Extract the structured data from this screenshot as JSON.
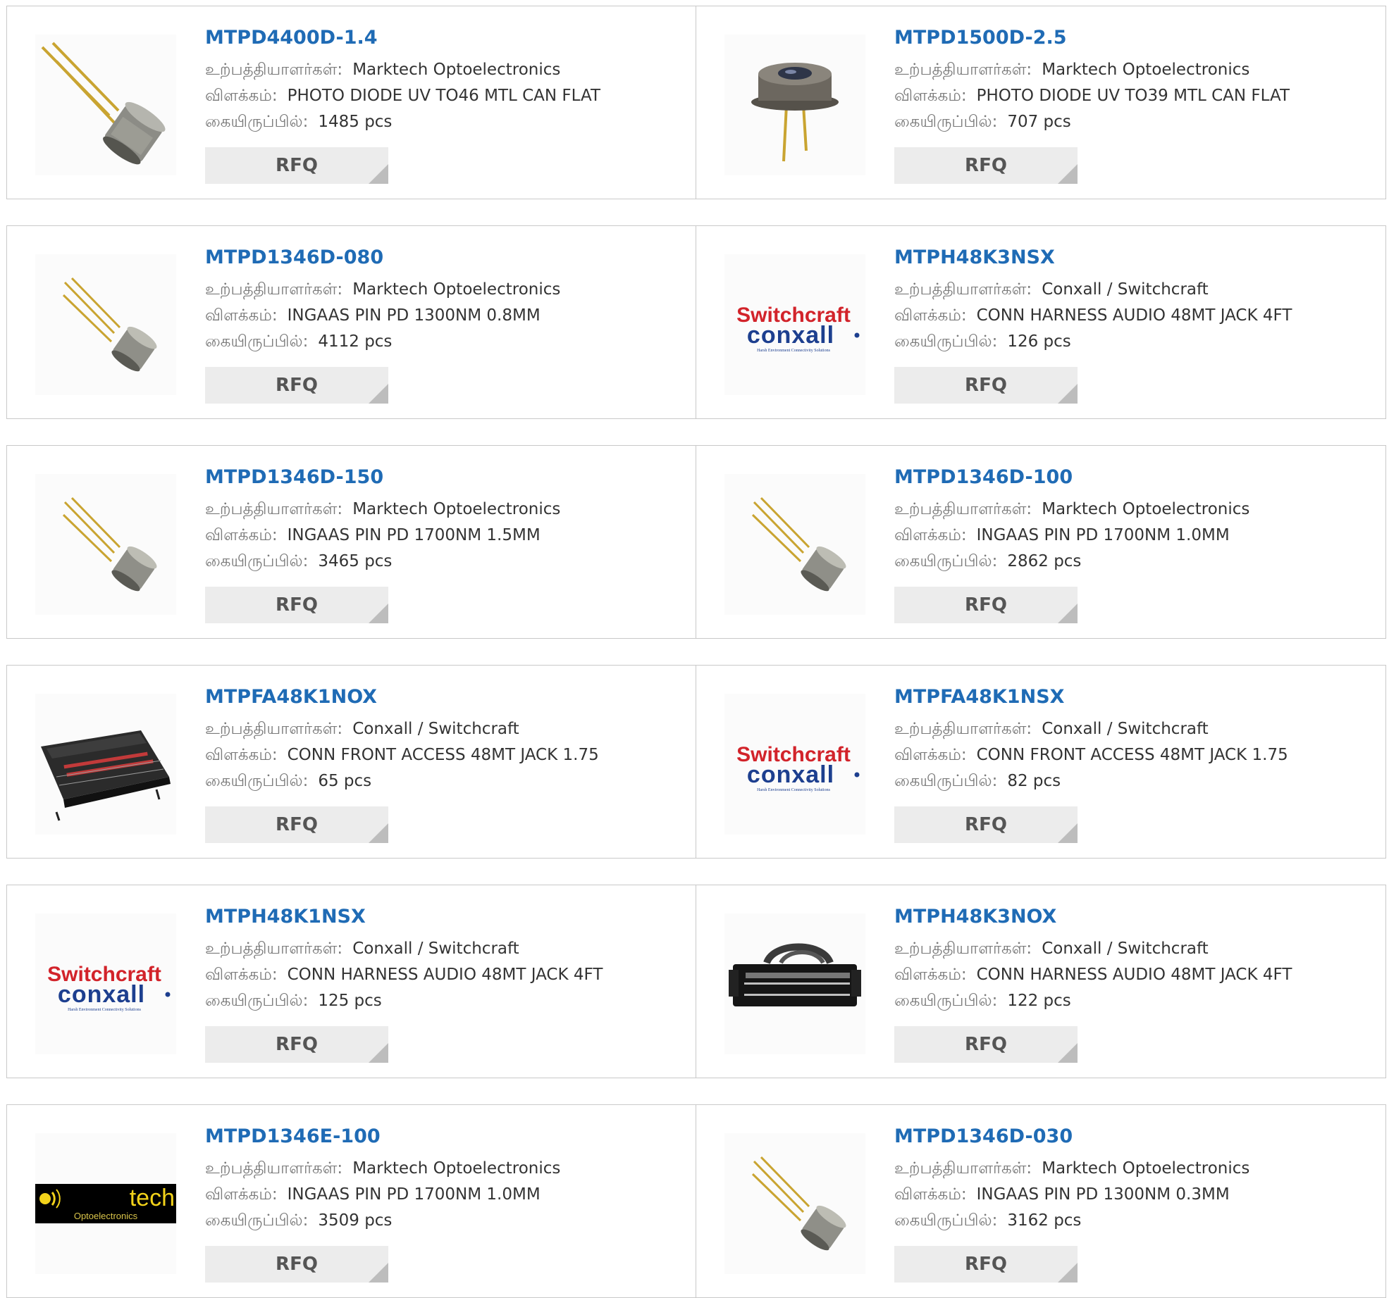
{
  "labels": {
    "manufacturer": "உற்பத்தியாளர்கள்:",
    "description": "விளக்கம்:",
    "stock": "கையிருப்பில்:",
    "rfq": "RFQ"
  },
  "products": [
    {
      "part": "MTPD4400D-1.4",
      "manufacturer": "Marktech Optoelectronics",
      "description": "PHOTO DIODE UV TO46 MTL CAN FLAT",
      "stock": "1485 pcs",
      "image": "photodiode-can-long-leads"
    },
    {
      "part": "MTPD1500D-2.5",
      "manufacturer": "Marktech Optoelectronics",
      "description": "PHOTO DIODE UV TO39 MTL CAN FLAT",
      "stock": "707 pcs",
      "image": "photodiode-to39-window"
    },
    {
      "part": "MTPD1346D-080",
      "manufacturer": "Marktech Optoelectronics",
      "description": "INGAAS PIN PD 1300NM 0.8MM",
      "stock": "4112 pcs",
      "image": "photodiode-can-small"
    },
    {
      "part": "MTPH48K3NSX",
      "manufacturer": "Conxall / Switchcraft",
      "description": "CONN HARNESS AUDIO 48MT JACK 4FT",
      "stock": "126 pcs",
      "image": "switchcraft-conxall-logo"
    },
    {
      "part": "MTPD1346D-150",
      "manufacturer": "Marktech Optoelectronics",
      "description": "INGAAS PIN PD 1700NM 1.5MM",
      "stock": "3465 pcs",
      "image": "photodiode-can-small"
    },
    {
      "part": "MTPD1346D-100",
      "manufacturer": "Marktech Optoelectronics",
      "description": "INGAAS PIN PD 1700NM 1.0MM",
      "stock": "2862 pcs",
      "image": "photodiode-can-small"
    },
    {
      "part": "MTPFA48K1NOX",
      "manufacturer": "Conxall / Switchcraft",
      "description": "CONN FRONT ACCESS 48MT JACK 1.75",
      "stock": "65 pcs",
      "image": "patch-panel-tray"
    },
    {
      "part": "MTPFA48K1NSX",
      "manufacturer": "Conxall / Switchcraft",
      "description": "CONN FRONT ACCESS 48MT JACK 1.75",
      "stock": "82 pcs",
      "image": "switchcraft-conxall-logo"
    },
    {
      "part": "MTPH48K1NSX",
      "manufacturer": "Conxall / Switchcraft",
      "description": "CONN HARNESS AUDIO 48MT JACK 4FT",
      "stock": "125 pcs",
      "image": "switchcraft-conxall-logo"
    },
    {
      "part": "MTPH48K3NOX",
      "manufacturer": "Conxall / Switchcraft",
      "description": "CONN HARNESS AUDIO 48MT JACK 4FT",
      "stock": "122 pcs",
      "image": "patch-panel-harness"
    },
    {
      "part": "MTPD1346E-100",
      "manufacturer": "Marktech Optoelectronics",
      "description": "INGAAS PIN PD 1700NM 1.0MM",
      "stock": "3509 pcs",
      "image": "marktech-optoelectronics-logo"
    },
    {
      "part": "MTPD1346D-030",
      "manufacturer": "Marktech Optoelectronics",
      "description": "INGAAS PIN PD 1300NM 0.3MM",
      "stock": "3162 pcs",
      "image": "photodiode-can-small"
    }
  ],
  "logos": {
    "switchcraft": {
      "top": "Switchcraft",
      "bottom": "conxall",
      "tagline": "Harsh Environment Connectivity Solutions"
    },
    "marktech": {
      "brand": "tech",
      "sub": "Optoelectronics"
    }
  },
  "colors": {
    "link": "#1f6bb5",
    "switchcraft_red": "#d2232a",
    "conxall_blue": "#1d3f8f",
    "rfq_bg": "#ececec"
  }
}
